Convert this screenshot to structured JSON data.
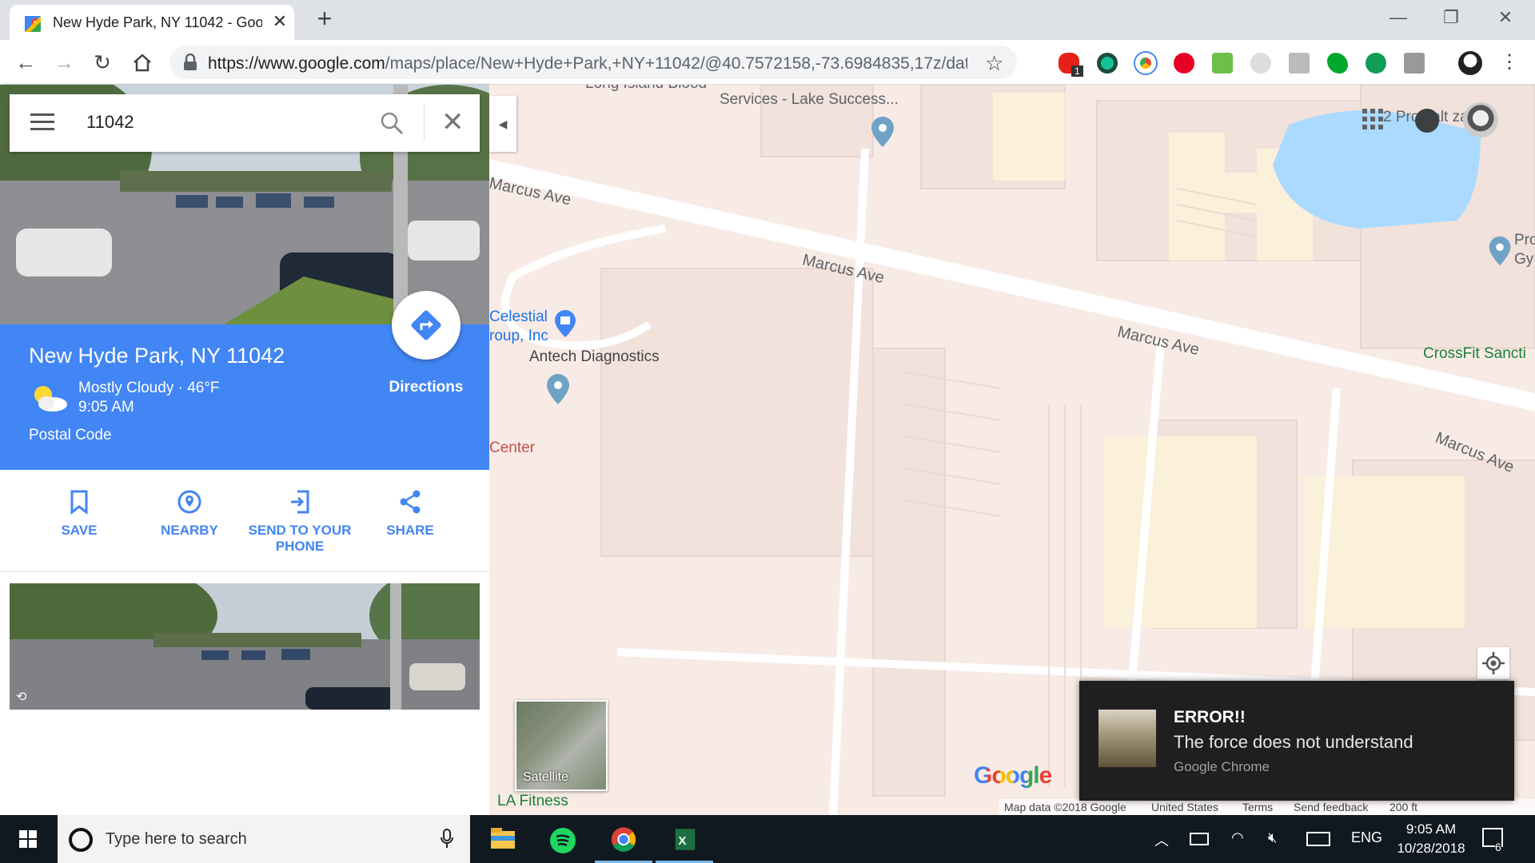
{
  "browser": {
    "tab_title": "New Hyde Park, NY 11042 - Goo",
    "new_tab": "+",
    "url_host": "https://www.google.com",
    "url_path": "/maps/place/New+Hyde+Park,+NY+11042/@40.7572158,-73.6984835,17z/dat...",
    "extensions": [
      "adblock-icon",
      "grammarly-icon",
      "chrome-apps-icon",
      "pinterest-icon",
      "evernote-clipper-icon",
      "gray-icon",
      "screenshot-icon",
      "evernote-icon",
      "hangouts-icon",
      "notion-icon",
      "profile-avatar"
    ],
    "badge_count": "1"
  },
  "search": {
    "query": "11042"
  },
  "place": {
    "title": "New Hyde Park, NY 11042",
    "weather": "Mostly Cloudy · 46°F",
    "time": "9:05 AM",
    "category": "Postal Code",
    "directions_label": "Directions"
  },
  "actions": [
    {
      "label": "SAVE",
      "icon": "bookmark-icon"
    },
    {
      "label": "NEARBY",
      "icon": "nearby-pin-icon"
    },
    {
      "label": "SEND TO YOUR PHONE",
      "icon": "send-to-phone-icon"
    },
    {
      "label": "SHARE",
      "icon": "share-icon"
    }
  ],
  "map": {
    "labels": {
      "blood_services_line1": "Long Island Blood",
      "blood_services_line2": "Services - Lake Success...",
      "marcus_ave_1": "Marcus Ave",
      "marcus_ave_2": "Marcus Ave",
      "marcus_ave_3": "Marcus Ave",
      "marcus_ave_4": "Marcus Ave",
      "celestial_line1": "Celestial",
      "celestial_line2": "roup, Inc",
      "antech": "Antech Diagnostics",
      "center": "Center",
      "crossfit": "CrossFit Sancti",
      "pro_gym_line1": "Pro",
      "pro_gym_line2": "Gy",
      "plaza": "2 Pro ealt za",
      "la_fitness": "LA Fitness"
    },
    "satellite_label": "Satellite",
    "logo": "Google",
    "footer": {
      "map_data": "Map data ©2018 Google",
      "country": "United States",
      "terms": "Terms",
      "feedback": "Send feedback",
      "scale": "200 ft"
    }
  },
  "notification": {
    "heading": "ERROR!!",
    "message": "The force does not understand",
    "source": "Google Chrome"
  },
  "taskbar": {
    "search_placeholder": "Type here to search",
    "apps": [
      "file-explorer-icon",
      "spotify-icon",
      "chrome-icon",
      "excel-icon"
    ],
    "language": "ENG",
    "time": "9:05 AM",
    "date": "10/28/2018",
    "notification_count": "6"
  },
  "colors": {
    "accent": "#4285f4",
    "map_bg": "#f8ebe6",
    "water": "#aadaff",
    "taskbar": "#101820"
  }
}
